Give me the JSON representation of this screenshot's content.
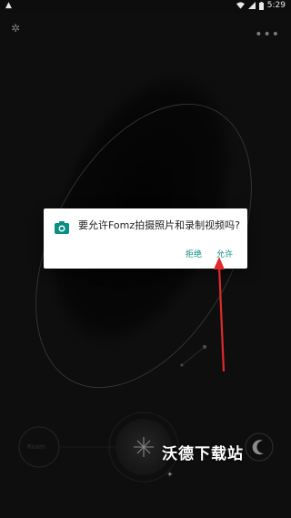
{
  "status_bar": {
    "time": "5:29",
    "alert_icon": "warning-triangle-icon",
    "wifi_icon": "wifi-icon",
    "signal_icon": "signal-icon",
    "battery_icon": "battery-icon"
  },
  "top_bar": {
    "left_icon": "aperture-icon",
    "right_icon": "more-dots-icon"
  },
  "permission_dialog": {
    "icon": "camera-icon",
    "message": "要允许Fomz拍摄照片和录制视频吗?",
    "deny_label": "拒绝",
    "allow_label": "允许",
    "accent_color": "#0a8f84"
  },
  "bottom_controls": {
    "left_dial_label": "Roam",
    "shutter_icon": "sparkle-shutter-icon",
    "moon_icon": "moon-icon"
  },
  "watermark": "沃德下载站",
  "annotation": {
    "arrow_color": "#e02a2a"
  }
}
